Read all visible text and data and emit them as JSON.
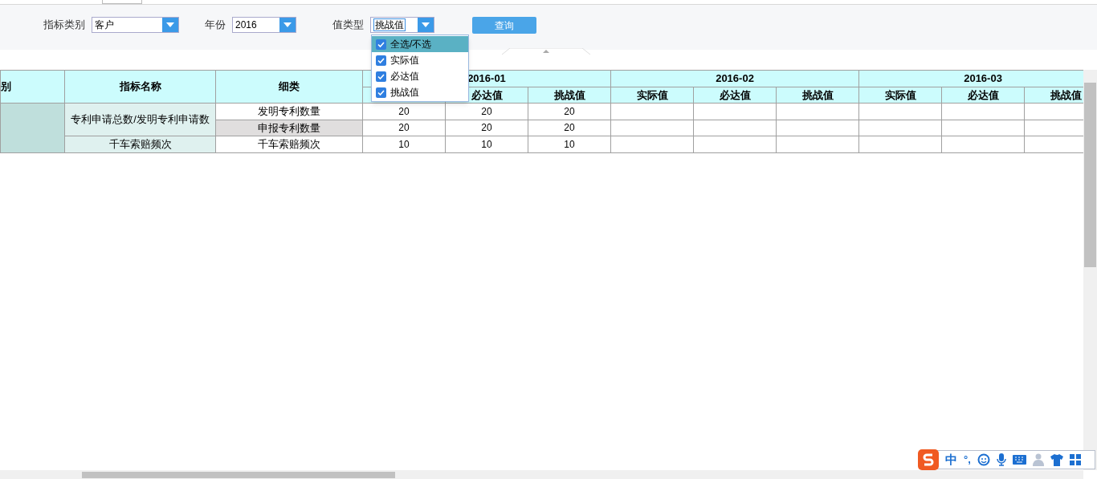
{
  "filters": [
    {
      "label": "指标类别",
      "value": "客户"
    },
    {
      "label": "年份",
      "value": "2016"
    },
    {
      "label": "值类型",
      "value": "挑战值",
      "open": true
    }
  ],
  "query_button": "查询",
  "dropdown": [
    {
      "label": "全选/不选",
      "checked": true,
      "selected": true
    },
    {
      "label": "实际值",
      "checked": true,
      "selected": false
    },
    {
      "label": "必达值",
      "checked": true,
      "selected": false
    },
    {
      "label": "挑战值",
      "checked": true,
      "selected": false
    }
  ],
  "table": {
    "columns": [
      "别",
      "指标名称",
      "细类"
    ],
    "months": [
      {
        "label": "2016-01",
        "subcolumns": [
          null,
          "必达值",
          "挑战值"
        ]
      },
      {
        "label": "2016-02",
        "subcolumns": [
          "实际值",
          "必达值",
          "挑战值"
        ]
      },
      {
        "label": "2016-03",
        "subcolumns": [
          "实际值",
          "必达值",
          "挑战值"
        ]
      }
    ],
    "groups": [
      {
        "name": "专利申请总数/发明专利申请数",
        "rows": [
          {
            "subcategory": "发明专利数量",
            "selected": false,
            "values": [
              "20",
              "20",
              "20"
            ]
          },
          {
            "subcategory": "申报专利数量",
            "selected": true,
            "values": [
              "20",
              "20",
              "20"
            ]
          }
        ]
      },
      {
        "name": "千车索赔频次",
        "rows": [
          {
            "subcategory": "千车索赔频次",
            "selected": false,
            "values": [
              "10",
              "10",
              "10"
            ]
          }
        ]
      }
    ]
  },
  "ime_toolbar": {
    "mode": "中",
    "punctuation": "°,"
  }
}
